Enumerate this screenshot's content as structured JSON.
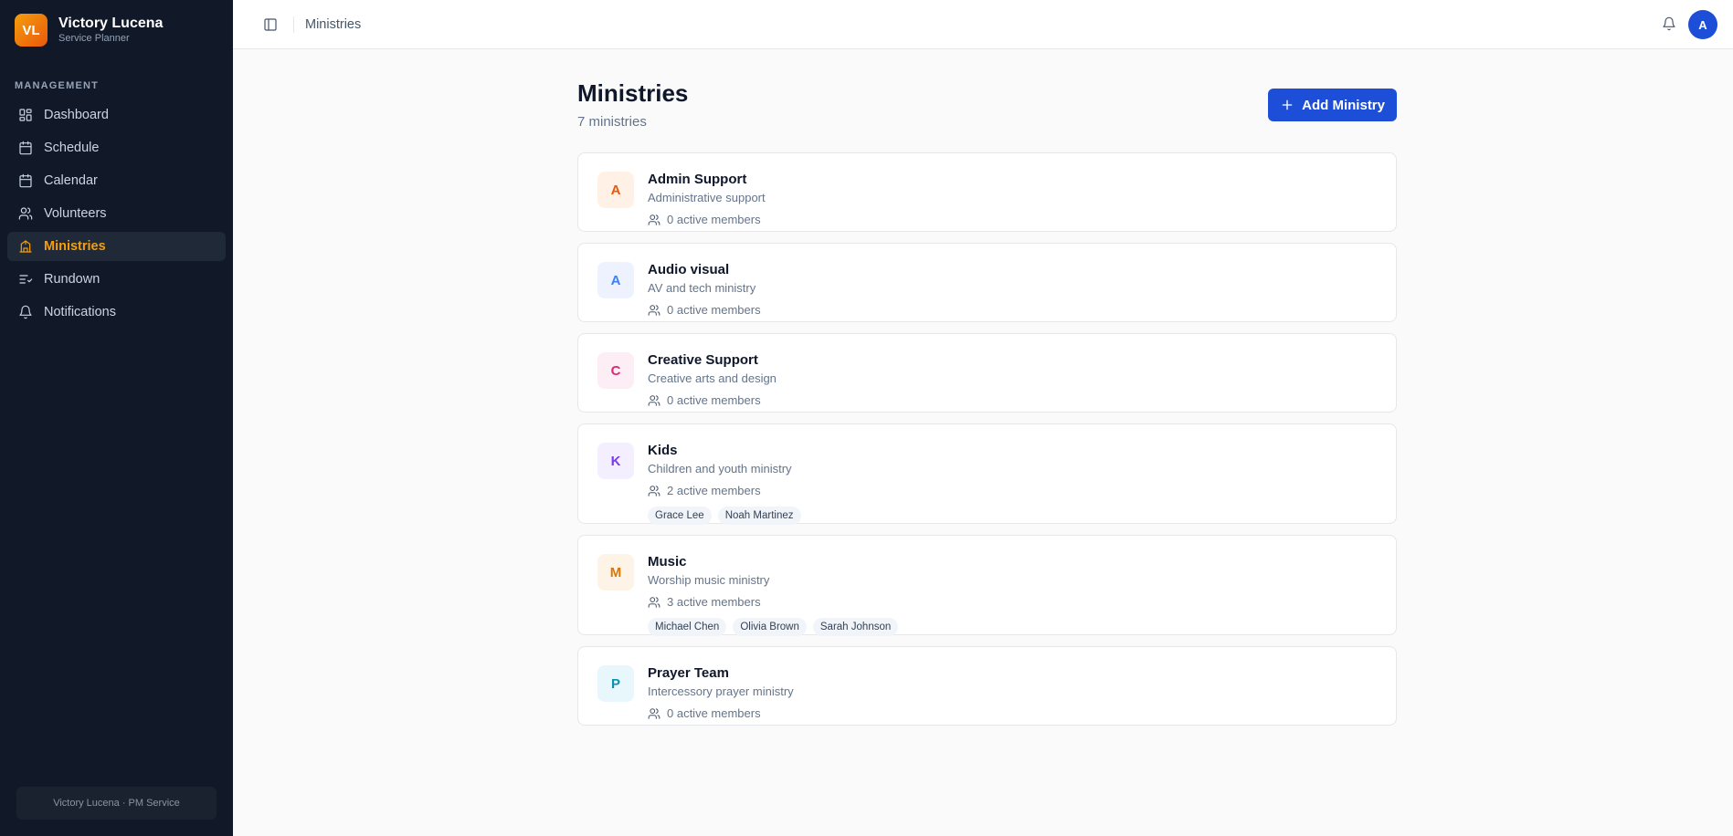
{
  "brand": {
    "initials": "VL",
    "name": "Victory Lucena",
    "subtitle": "Service Planner"
  },
  "sidebar": {
    "section_label": "MANAGEMENT",
    "items": [
      {
        "label": "Dashboard",
        "icon": "dashboard-icon",
        "active": false
      },
      {
        "label": "Schedule",
        "icon": "calendar-icon",
        "active": false
      },
      {
        "label": "Calendar",
        "icon": "calendar-icon",
        "active": false
      },
      {
        "label": "Volunteers",
        "icon": "users-icon",
        "active": false
      },
      {
        "label": "Ministries",
        "icon": "building-icon",
        "active": true
      },
      {
        "label": "Rundown",
        "icon": "list-icon",
        "active": false
      },
      {
        "label": "Notifications",
        "icon": "bell-icon",
        "active": false
      }
    ],
    "footer": "Victory Lucena · PM Service"
  },
  "topbar": {
    "breadcrumb": "Ministries",
    "avatar_initial": "A"
  },
  "page": {
    "title": "Ministries",
    "subtitle": "7 ministries",
    "add_button": "Add Ministry"
  },
  "colors": {
    "accent": "#f59e0b",
    "primary": "#1d4ed8",
    "sidebar_bg": "#111827"
  },
  "ministries": [
    {
      "initial": "A",
      "name": "Admin Support",
      "description": "Administrative support",
      "members_text": "0 active members",
      "members": [],
      "avatar_bg": "#fff1e6",
      "avatar_fg": "#ea580c"
    },
    {
      "initial": "A",
      "name": "Audio visual",
      "description": "AV and tech ministry",
      "members_text": "0 active members",
      "members": [],
      "avatar_bg": "#eef2ff",
      "avatar_fg": "#3b82f6"
    },
    {
      "initial": "C",
      "name": "Creative Support",
      "description": "Creative arts and design",
      "members_text": "0 active members",
      "members": [],
      "avatar_bg": "#fdeef5",
      "avatar_fg": "#db2777"
    },
    {
      "initial": "K",
      "name": "Kids",
      "description": "Children and youth ministry",
      "members_text": "2 active members",
      "members": [
        "Grace Lee",
        "Noah Martinez"
      ],
      "avatar_bg": "#f3efff",
      "avatar_fg": "#7c3aed"
    },
    {
      "initial": "M",
      "name": "Music",
      "description": "Worship music ministry",
      "members_text": "3 active members",
      "members": [
        "Michael Chen",
        "Olivia Brown",
        "Sarah Johnson"
      ],
      "avatar_bg": "#fdf3e6",
      "avatar_fg": "#d97706"
    },
    {
      "initial": "P",
      "name": "Prayer Team",
      "description": "Intercessory prayer ministry",
      "members_text": "0 active members",
      "members": [],
      "avatar_bg": "#e8f7fb",
      "avatar_fg": "#0891b2"
    }
  ]
}
